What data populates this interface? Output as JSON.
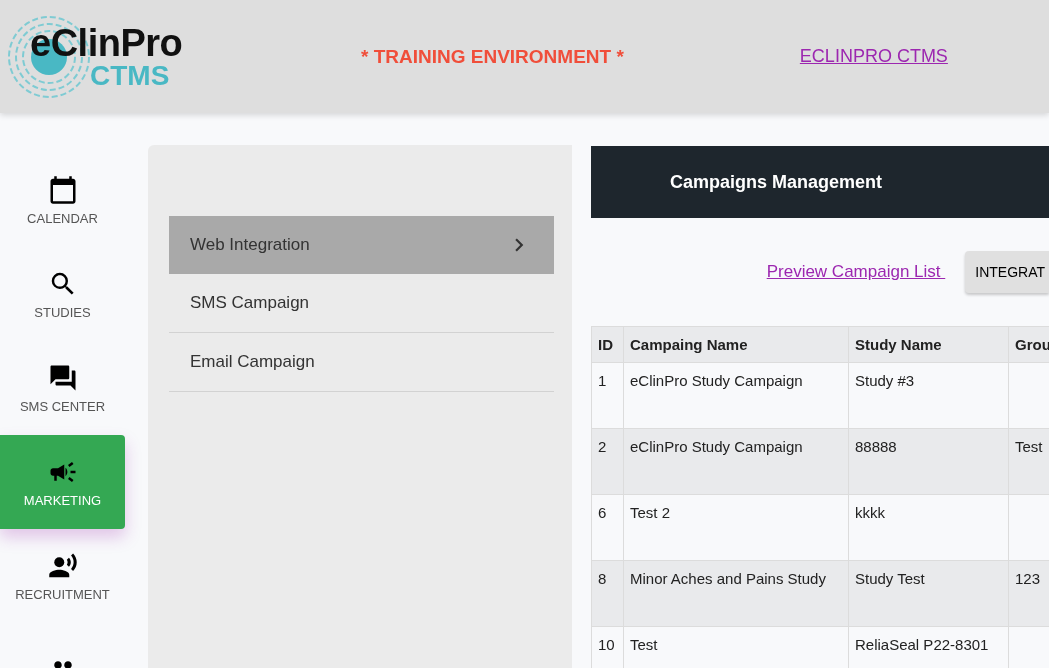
{
  "header": {
    "logo": {
      "word": "eClinPro",
      "product": "CTMS"
    },
    "notice": "* TRAINING ENVIRONMENT *",
    "link": "ECLINPRO CTMS"
  },
  "sidebar": {
    "items": [
      {
        "kind": "calendar",
        "label": "CALENDAR",
        "selected": false
      },
      {
        "kind": "search",
        "label": "STUDIES",
        "selected": false
      },
      {
        "kind": "chat",
        "label": "SMS CENTER",
        "selected": false
      },
      {
        "kind": "megaphone",
        "label": "MARKETING",
        "selected": true
      },
      {
        "kind": "speaker",
        "label": "RECRUITMENT",
        "selected": false
      },
      {
        "kind": "people",
        "selected": false
      }
    ]
  },
  "submenu": {
    "items": [
      {
        "label": "Web Integration",
        "selected": true
      },
      {
        "label": "SMS Campaign",
        "selected": false
      },
      {
        "label": "Email Campaign",
        "selected": false
      }
    ]
  },
  "content": {
    "title": "Campaigns Management",
    "preview_link": "Preview Campaign List ",
    "button": "INTEGRAT",
    "table": {
      "columns": [
        "ID",
        "Campaing Name",
        "Study Name",
        "Grou"
      ],
      "rows": [
        [
          "1",
          "eClinPro Study Campaign",
          "Study #3",
          ""
        ],
        [
          "2",
          "eClinPro Study Campaign",
          "88888",
          "Test"
        ],
        [
          "6",
          "Test 2",
          "kkkk",
          ""
        ],
        [
          "8",
          "Minor Aches and Pains Study",
          "Study Test",
          "123"
        ],
        [
          "10",
          "Test",
          "ReliaSeal P22-8301",
          ""
        ]
      ]
    }
  }
}
